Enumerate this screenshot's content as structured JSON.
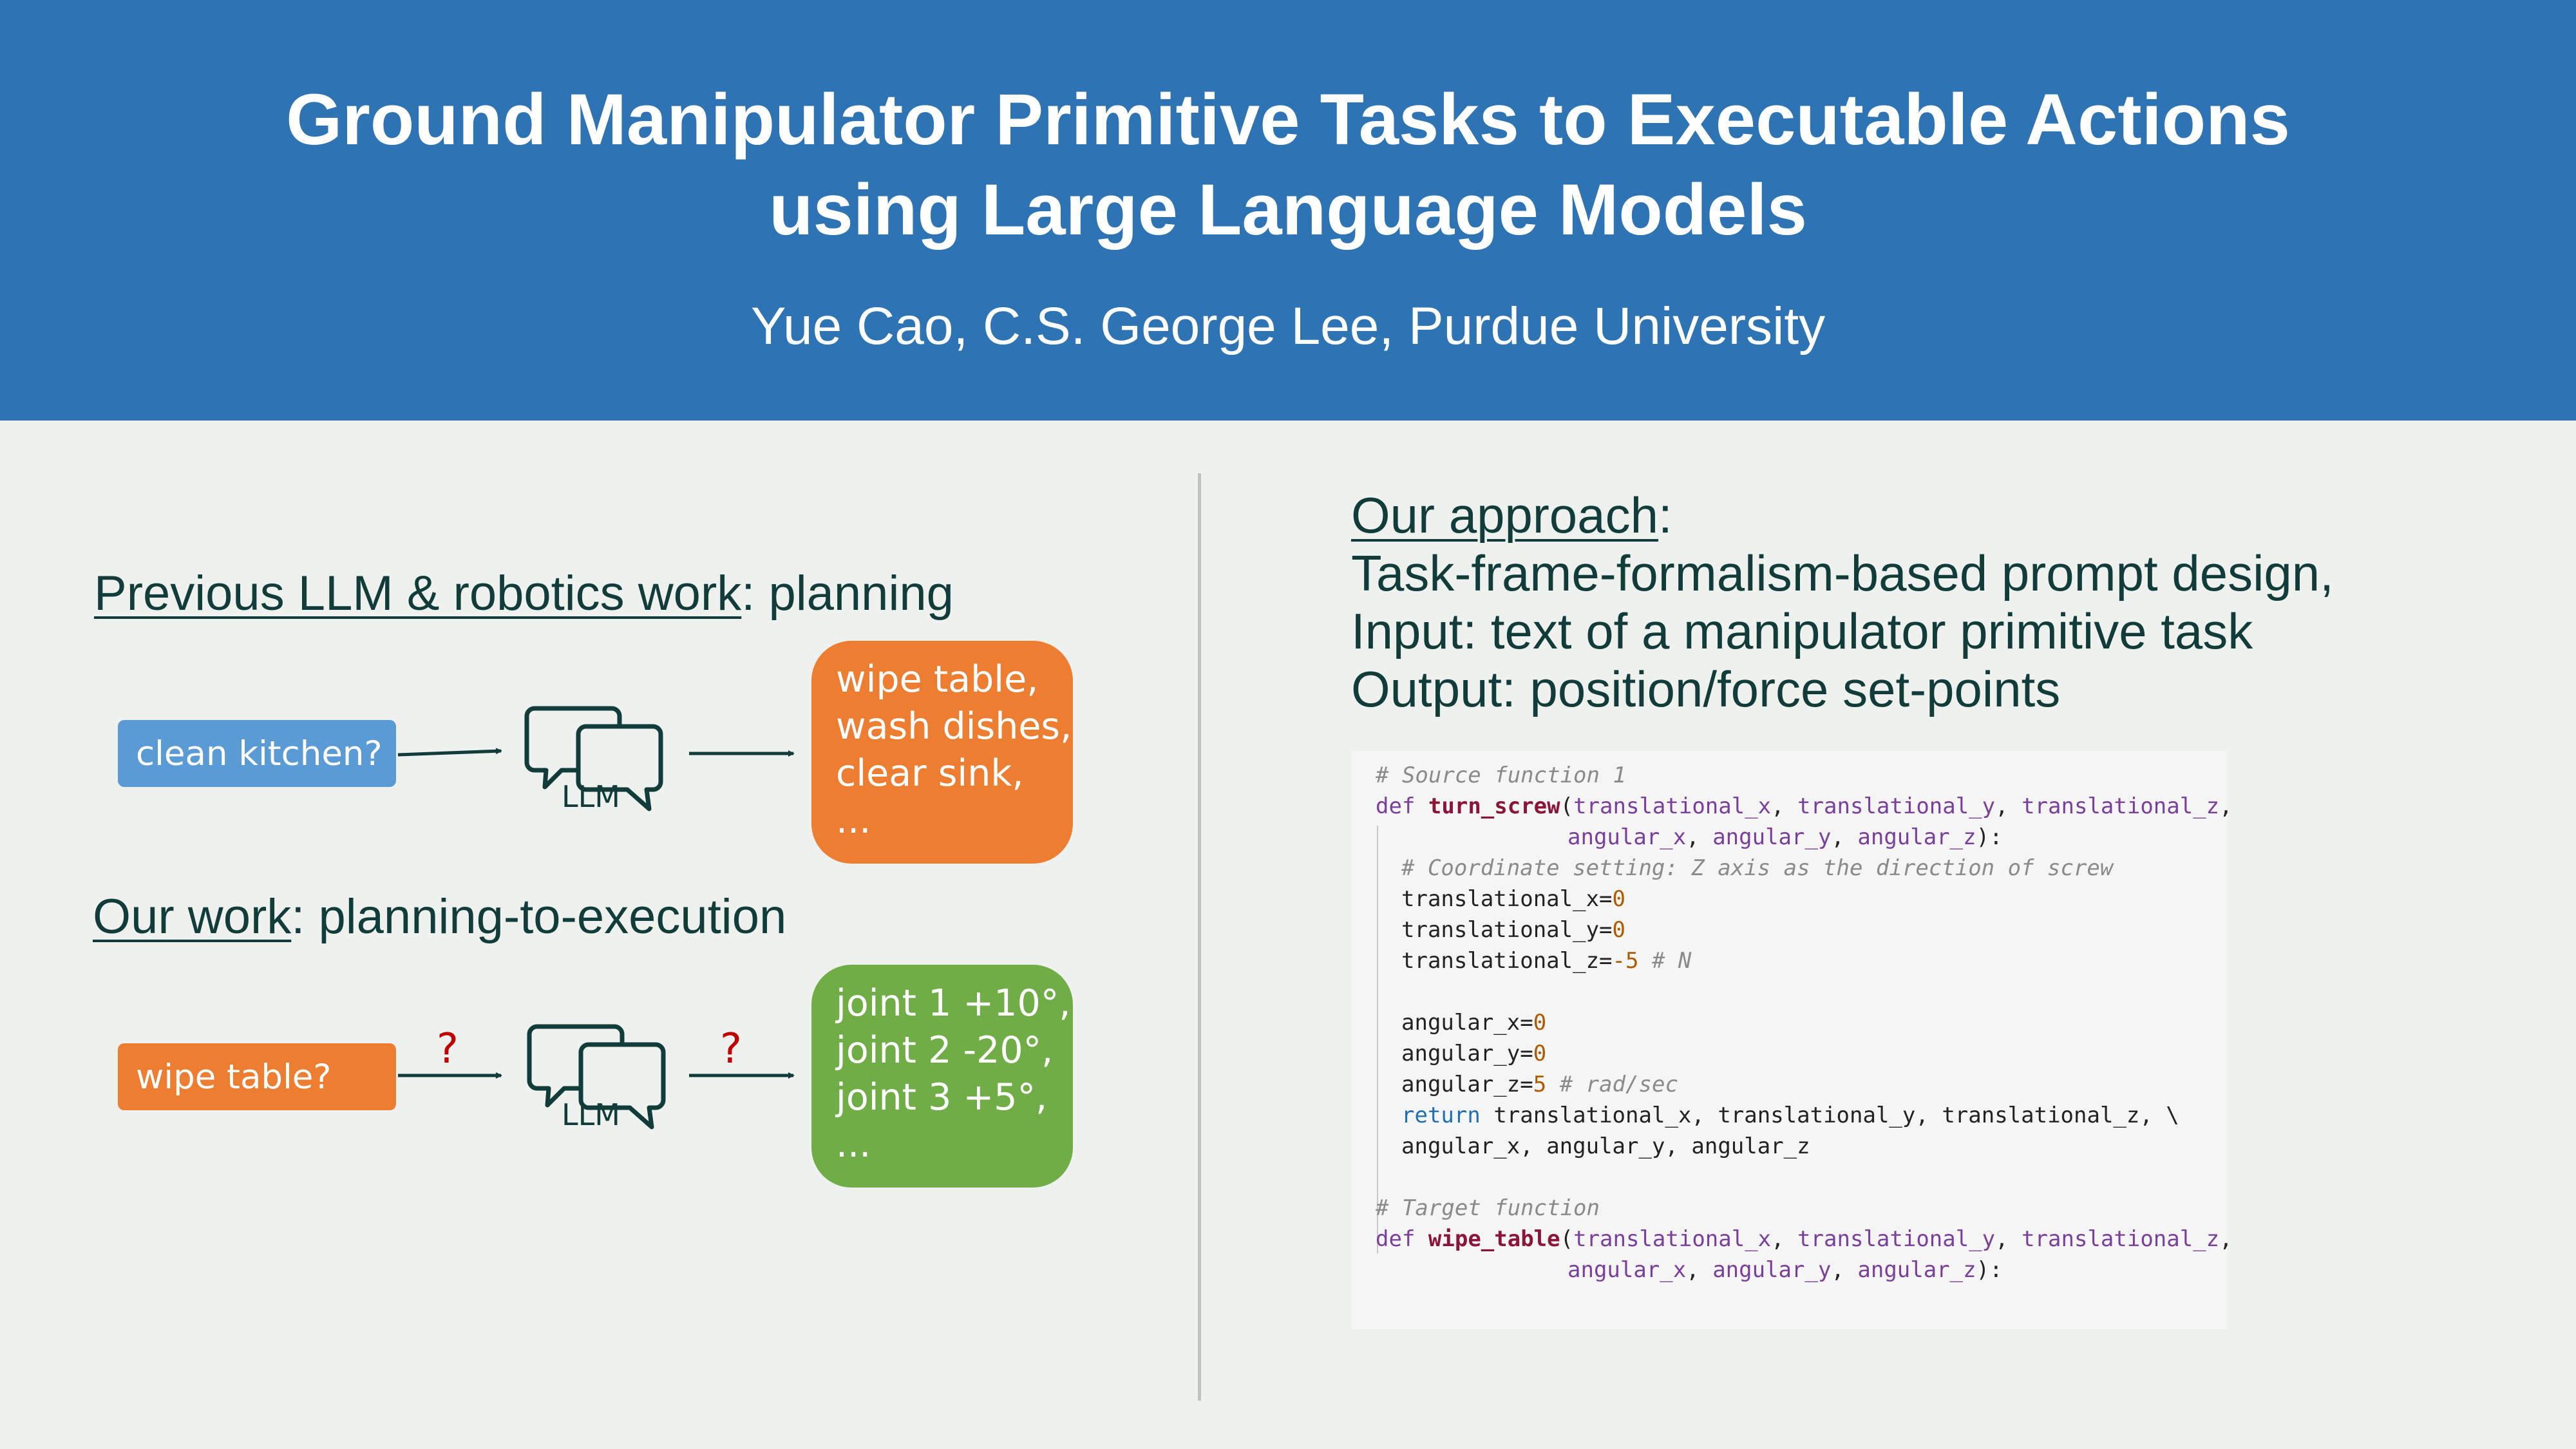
{
  "header": {
    "title_line1": "Ground Manipulator Primitive Tasks to Executable Actions",
    "title_line2": "using Large Language Models",
    "authors": "Yue Cao, C.S. George Lee, Purdue University"
  },
  "left": {
    "prev_heading_underlined": "Previous LLM & robotics work",
    "prev_heading_rest": ": planning",
    "prev_input": "clean kitchen?",
    "prev_llm": "LLM",
    "prev_output": [
      "wipe table,",
      "wash dishes,",
      "clear sink,",
      "..."
    ],
    "our_heading_underlined": "Our work",
    "our_heading_rest": ": planning-to-execution",
    "our_input": "wipe table?",
    "our_llm": "LLM",
    "qmark": "?",
    "our_output": [
      "joint 1 +10°,",
      "joint 2 -20°,",
      "joint 3 +5°,",
      "..."
    ]
  },
  "right": {
    "approach_underlined": "Our approach",
    "approach_colon": ":",
    "lines": [
      "Task-frame-formalism-based prompt design,",
      "Input: text of a manipulator primitive task",
      "Output: position/force set-points"
    ],
    "code": {
      "c1": "# Source function 1",
      "def": "def",
      "fn1": "turn_screw",
      "p_tx": "translational_x",
      "p_ty": "translational_y",
      "p_tz": "translational_z",
      "p_ax": "angular_x",
      "p_ay": "angular_y",
      "p_az": "angular_z",
      "c2": "# Coordinate setting: Z axis as the direction of screw",
      "v_tx": "0",
      "v_ty": "0",
      "v_tz": "-5",
      "c_n": "# N",
      "v_ax": "0",
      "v_ay": "0",
      "v_az": "5",
      "c_rad": "# rad/sec",
      "ret": "return",
      "c3": "# Target function",
      "fn2": "wipe_table"
    }
  },
  "colors": {
    "header_bg": "#2e74b5",
    "blue_box": "#5b9bd5",
    "orange_box": "#ed7d31",
    "green_box": "#70ad47",
    "question_mark": "#c00000"
  }
}
